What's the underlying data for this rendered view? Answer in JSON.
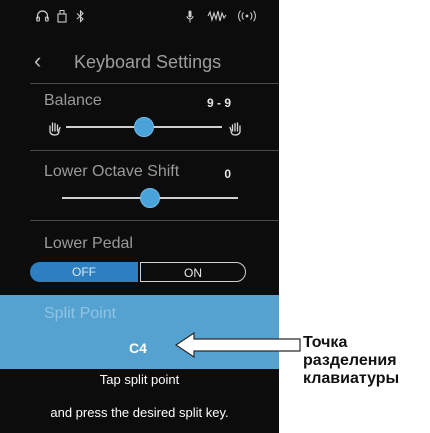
{
  "status_bar": {
    "icons": [
      "headphones-icon",
      "usb-icon",
      "bluetooth-icon",
      "microphone-icon",
      "audio-wave-icon",
      "wifi-icon"
    ]
  },
  "header": {
    "back_icon": "chevron-left-icon",
    "title": "Keyboard Settings"
  },
  "balance": {
    "label": "Balance",
    "value": "9 - 9",
    "level": 0.5
  },
  "lower_octave_shift": {
    "label": "Lower Octave Shift",
    "value": "0",
    "level": 0.5
  },
  "lower_pedal": {
    "label": "Lower Pedal",
    "off_label": "OFF",
    "on_label": "ON",
    "selected": "OFF"
  },
  "split_point": {
    "label": "Split Point",
    "key": "C4"
  },
  "instructions": {
    "line1": "Tap split point",
    "line2": "and press the desired split key."
  },
  "annotation": {
    "lines": [
      "Точка",
      "разделения",
      "клавиатуры"
    ]
  },
  "colors": {
    "accent": "#49a3d9",
    "split_panel": "#55a2d0",
    "background": "#0c0c0c",
    "toggle_active": "#2e7fbf"
  }
}
